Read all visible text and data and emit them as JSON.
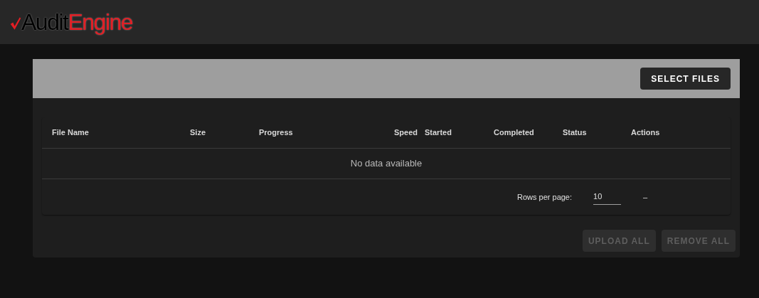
{
  "logo": {
    "first": "Audit",
    "second": "Engine"
  },
  "toolbar": {
    "select_button": "SELECT FILES"
  },
  "table": {
    "columns": [
      {
        "label": "File Name",
        "kind": "text"
      },
      {
        "label": "Size",
        "kind": "text"
      },
      {
        "label": "Progress",
        "kind": "text"
      },
      {
        "label": "Speed",
        "kind": "numeric"
      },
      {
        "label": "Started",
        "kind": "text"
      },
      {
        "label": "Completed",
        "kind": "text"
      },
      {
        "label": "Status",
        "kind": "text"
      },
      {
        "label": "Actions",
        "kind": "text"
      }
    ],
    "empty_message": "No data available",
    "footer": {
      "rows_per_page_label": "Rows per page:",
      "rows_per_page_value": "10",
      "page_range": "–"
    }
  },
  "actions": [
    {
      "label": "UPLOAD ALL",
      "disabled": true
    },
    {
      "label": "REMOVE ALL",
      "disabled": true
    }
  ]
}
